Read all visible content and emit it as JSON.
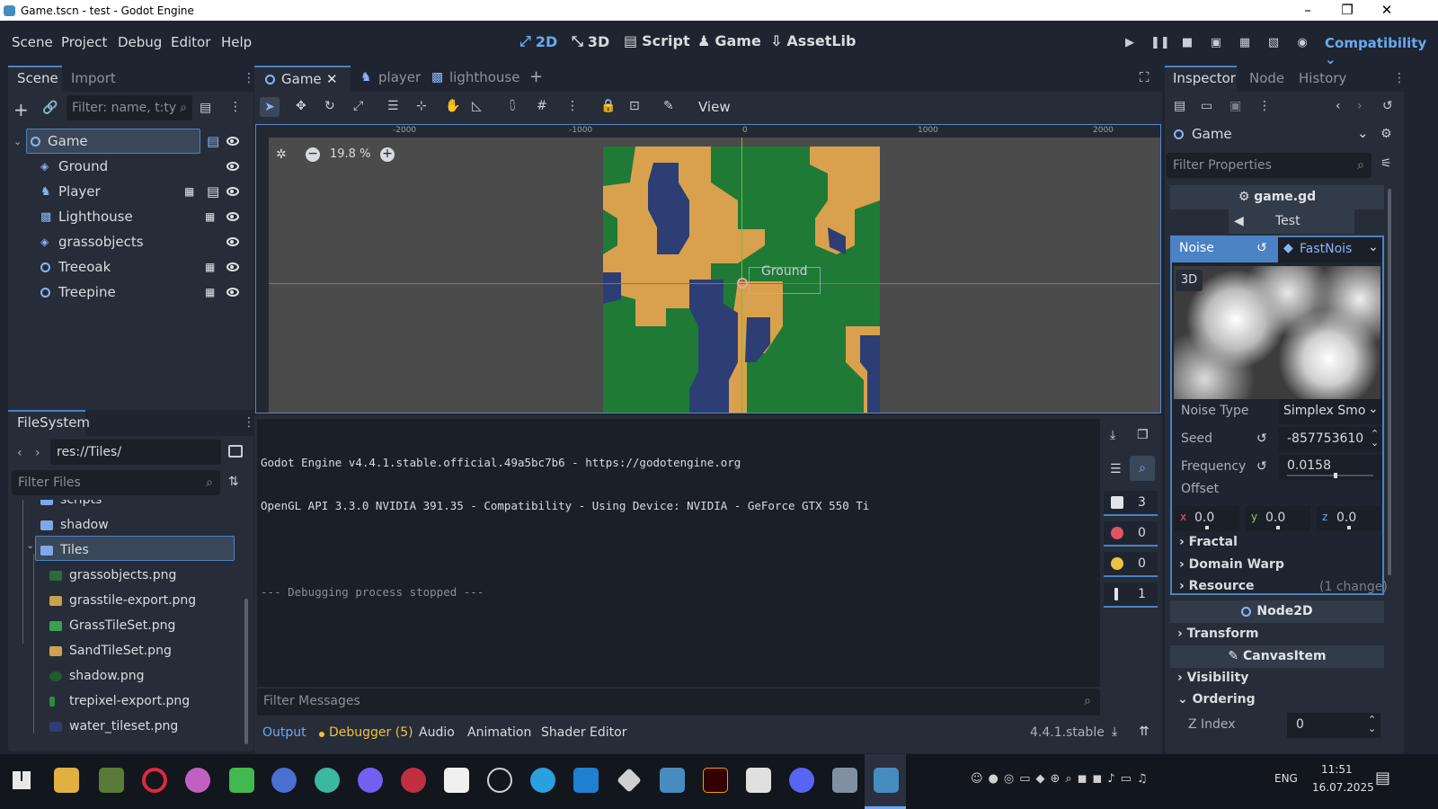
{
  "window": {
    "title": "Game.tscn - test - Godot Engine"
  },
  "menu": [
    "Scene",
    "Project",
    "Debug",
    "Editor",
    "Help"
  ],
  "workspaces": [
    {
      "label": "2D",
      "active": true
    },
    {
      "label": "3D",
      "active": false
    },
    {
      "label": "Script",
      "active": false
    },
    {
      "label": "Game",
      "active": false
    },
    {
      "label": "AssetLib",
      "active": false
    }
  ],
  "renderer": "Compatibility",
  "scene_dock": {
    "tabs": [
      "Scene",
      "Import"
    ],
    "filter_placeholder": "Filter: name, t:ty",
    "nodes": [
      {
        "name": "Game",
        "selected": true
      },
      {
        "name": "Ground"
      },
      {
        "name": "Player"
      },
      {
        "name": "Lighthouse"
      },
      {
        "name": "grassobjects"
      },
      {
        "name": "Treeoak"
      },
      {
        "name": "Treepine"
      }
    ]
  },
  "filesystem": {
    "title": "FileSystem",
    "path": "res://Tiles/",
    "filter_placeholder": "Filter Files",
    "items": [
      {
        "name": "scripts",
        "type": "folder"
      },
      {
        "name": "shadow",
        "type": "folder"
      },
      {
        "name": "Tiles",
        "type": "folder",
        "selected": true
      },
      {
        "name": "grassobjects.png",
        "type": "file"
      },
      {
        "name": "grasstile-export.png",
        "type": "file"
      },
      {
        "name": "GrassTileSet.png",
        "type": "file"
      },
      {
        "name": "SandTileSet.png",
        "type": "file"
      },
      {
        "name": "shadow.png",
        "type": "file"
      },
      {
        "name": "trepixel-export.png",
        "type": "file"
      },
      {
        "name": "water_tileset.png",
        "type": "file"
      }
    ]
  },
  "editor_tabs": [
    "Game",
    "player",
    "lighthouse"
  ],
  "toolbar": {
    "view_label": "View"
  },
  "viewport": {
    "zoom": "19.8 %",
    "ruler": [
      "-2000",
      "-1000",
      "0",
      "1000",
      "2000"
    ],
    "node_label": "Ground",
    "colors": {
      "grass": "#1f7a35",
      "sand": "#d9a14e",
      "water": "#2d3e75"
    }
  },
  "output": {
    "lines": [
      "Godot Engine v4.4.1.stable.official.49a5bc7b6 - https://godotengine.org",
      "OpenGL API 3.3.0 NVIDIA 391.35 - Compatibility - Using Device: NVIDIA - GeForce GTX 550 Ti",
      "",
      "--- Debugging process stopped ---"
    ],
    "filter_placeholder": "Filter Messages",
    "counts": {
      "messages": "3",
      "errors": "0",
      "warnings": "0",
      "editor": "1"
    }
  },
  "bottom_tabs": [
    "Output",
    "Debugger (5)",
    "Audio",
    "Animation",
    "Shader Editor"
  ],
  "version": "4.4.1.stable",
  "inspector": {
    "tabs": [
      "Inspector",
      "Node",
      "History"
    ],
    "object": "Game",
    "filter_placeholder": "Filter Properties",
    "script": "game.gd",
    "test_button": "Test",
    "noise_label": "Noise",
    "noise_resource": "FastNois",
    "preview_label": "3D",
    "noise_type_label": "Noise Type",
    "noise_type_value": "Simplex Smo",
    "seed_label": "Seed",
    "seed_value": "-857753610",
    "frequency_label": "Frequency",
    "frequency_value": "0.0158",
    "offset_label": "Offset",
    "offset": {
      "x": "0.0",
      "y": "0.0",
      "z": "0.0"
    },
    "sections": [
      "Fractal",
      "Domain Warp",
      "Resource"
    ],
    "resource_note": "(1 change)",
    "node2d": "Node2D",
    "transform": "Transform",
    "canvasitem": "CanvasItem",
    "visibility": "Visibility",
    "ordering": "Ordering",
    "zindex_label": "Z Index",
    "zindex_value": "0"
  },
  "taskbar": {
    "lang": "ENG",
    "time": "11:51",
    "date": "16.07.2025"
  }
}
